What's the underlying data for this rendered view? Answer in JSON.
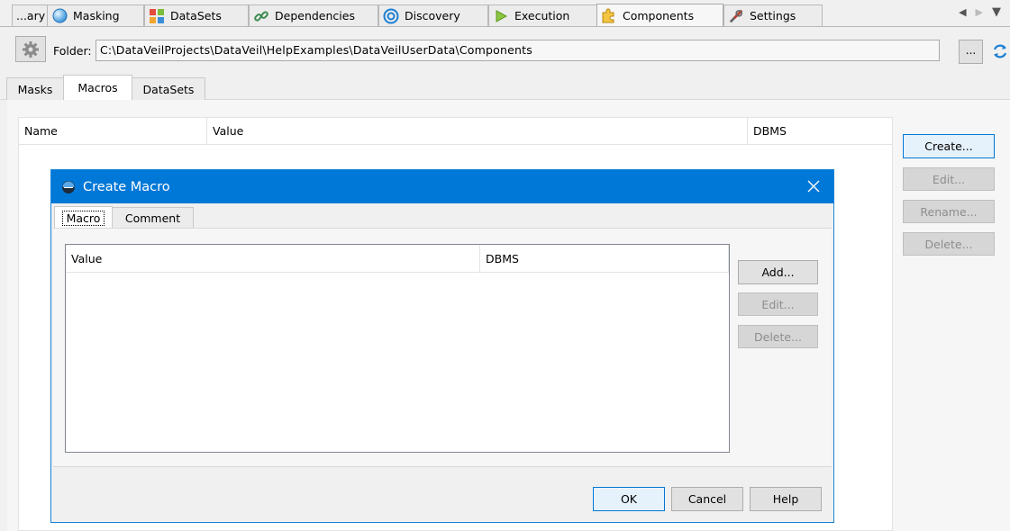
{
  "top_tabs": [
    {
      "label": "...ary",
      "icon": "none"
    },
    {
      "label": "Masking",
      "icon": "globe-icon"
    },
    {
      "label": "DataSets",
      "icon": "grid-icon"
    },
    {
      "label": "Dependencies",
      "icon": "link-icon"
    },
    {
      "label": "Discovery",
      "icon": "target-icon"
    },
    {
      "label": "Execution",
      "icon": "play-icon"
    },
    {
      "label": "Components",
      "icon": "puzzle-icon"
    },
    {
      "label": "Settings",
      "icon": "tools-icon"
    }
  ],
  "active_top_tab": "Components",
  "folder": {
    "label": "Folder:",
    "path": "C:\\DataVeilProjects\\DataVeil\\HelpExamples\\DataVeilUserData\\Components",
    "browse_label": "..."
  },
  "sub_tabs": [
    "Masks",
    "Macros",
    "DataSets"
  ],
  "active_sub_tab": "Macros",
  "main_table": {
    "columns": [
      "Name",
      "Value",
      "DBMS"
    ],
    "rows": []
  },
  "side_buttons": {
    "create": "Create...",
    "edit": "Edit...",
    "rename": "Rename...",
    "delete": "Delete..."
  },
  "dialog": {
    "title": "Create Macro",
    "tabs": [
      "Macro",
      "Comment"
    ],
    "active_tab": "Macro",
    "table": {
      "columns": [
        "Value",
        "DBMS"
      ],
      "rows": []
    },
    "buttons": {
      "add": "Add...",
      "edit": "Edit...",
      "delete": "Delete..."
    },
    "footer": {
      "ok": "OK",
      "cancel": "Cancel",
      "help": "Help"
    }
  },
  "colors": {
    "title_bar": "#0078d7",
    "background": "#f0f0f0",
    "disabled_text": "#8d8d8d"
  }
}
